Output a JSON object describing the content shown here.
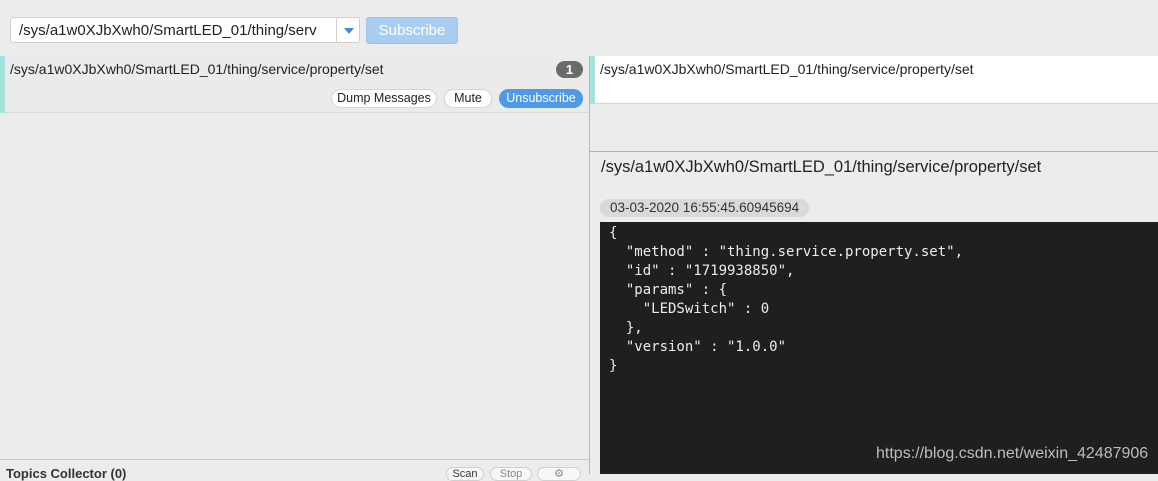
{
  "header": {
    "topic_value": "/sys/a1w0XJbXwh0/SmartLED_01/thing/serv",
    "subscribe_label": "Subscribe"
  },
  "subscriptions": [
    {
      "topic": "/sys/a1w0XJbXwh0/SmartLED_01/thing/service/property/set",
      "count": "1",
      "dump_label": "Dump Messages",
      "mute_label": "Mute",
      "unsubscribe_label": "Unsubscribe"
    }
  ],
  "collector": {
    "label": "Topics Collector (0)",
    "save_label": "Scan",
    "stop_label": "Stop",
    "config_label": "⚙"
  },
  "detail": {
    "selected_topic": "/sys/a1w0XJbXwh0/SmartLED_01/thing/service/property/set",
    "message_topic": "/sys/a1w0XJbXwh0/SmartLED_01/thing/service/property/set",
    "timestamp": "03-03-2020  16:55:45.60945694",
    "payload": "{\n  \"method\" : \"thing.service.property.set\",\n  \"id\" : \"1719938850\",\n  \"params\" : {\n    \"LEDSwitch\" : 0\n  },\n  \"version\" : \"1.0.0\"\n}"
  },
  "watermark": "https://blog.csdn.net/weixin_42487906",
  "colors": {
    "accent": "#a6e3df",
    "primary": "#4f9ae6",
    "subscribe_disabled": "#a9cdf0",
    "payload_bg": "#1f1f1f"
  }
}
